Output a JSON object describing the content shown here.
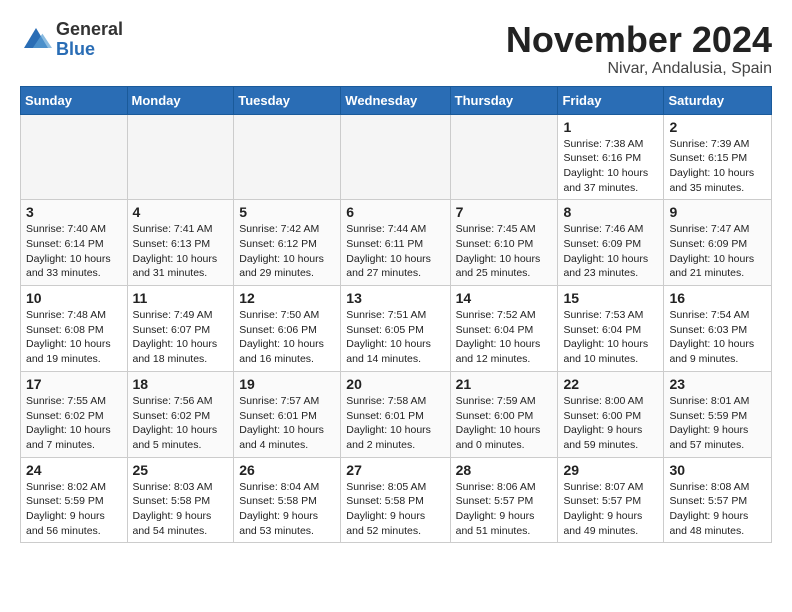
{
  "header": {
    "logo_general": "General",
    "logo_blue": "Blue",
    "month_title": "November 2024",
    "location": "Nivar, Andalusia, Spain"
  },
  "weekdays": [
    "Sunday",
    "Monday",
    "Tuesday",
    "Wednesday",
    "Thursday",
    "Friday",
    "Saturday"
  ],
  "weeks": [
    [
      {
        "day": "",
        "info": ""
      },
      {
        "day": "",
        "info": ""
      },
      {
        "day": "",
        "info": ""
      },
      {
        "day": "",
        "info": ""
      },
      {
        "day": "",
        "info": ""
      },
      {
        "day": "1",
        "info": "Sunrise: 7:38 AM\nSunset: 6:16 PM\nDaylight: 10 hours and 37 minutes."
      },
      {
        "day": "2",
        "info": "Sunrise: 7:39 AM\nSunset: 6:15 PM\nDaylight: 10 hours and 35 minutes."
      }
    ],
    [
      {
        "day": "3",
        "info": "Sunrise: 7:40 AM\nSunset: 6:14 PM\nDaylight: 10 hours and 33 minutes."
      },
      {
        "day": "4",
        "info": "Sunrise: 7:41 AM\nSunset: 6:13 PM\nDaylight: 10 hours and 31 minutes."
      },
      {
        "day": "5",
        "info": "Sunrise: 7:42 AM\nSunset: 6:12 PM\nDaylight: 10 hours and 29 minutes."
      },
      {
        "day": "6",
        "info": "Sunrise: 7:44 AM\nSunset: 6:11 PM\nDaylight: 10 hours and 27 minutes."
      },
      {
        "day": "7",
        "info": "Sunrise: 7:45 AM\nSunset: 6:10 PM\nDaylight: 10 hours and 25 minutes."
      },
      {
        "day": "8",
        "info": "Sunrise: 7:46 AM\nSunset: 6:09 PM\nDaylight: 10 hours and 23 minutes."
      },
      {
        "day": "9",
        "info": "Sunrise: 7:47 AM\nSunset: 6:09 PM\nDaylight: 10 hours and 21 minutes."
      }
    ],
    [
      {
        "day": "10",
        "info": "Sunrise: 7:48 AM\nSunset: 6:08 PM\nDaylight: 10 hours and 19 minutes."
      },
      {
        "day": "11",
        "info": "Sunrise: 7:49 AM\nSunset: 6:07 PM\nDaylight: 10 hours and 18 minutes."
      },
      {
        "day": "12",
        "info": "Sunrise: 7:50 AM\nSunset: 6:06 PM\nDaylight: 10 hours and 16 minutes."
      },
      {
        "day": "13",
        "info": "Sunrise: 7:51 AM\nSunset: 6:05 PM\nDaylight: 10 hours and 14 minutes."
      },
      {
        "day": "14",
        "info": "Sunrise: 7:52 AM\nSunset: 6:04 PM\nDaylight: 10 hours and 12 minutes."
      },
      {
        "day": "15",
        "info": "Sunrise: 7:53 AM\nSunset: 6:04 PM\nDaylight: 10 hours and 10 minutes."
      },
      {
        "day": "16",
        "info": "Sunrise: 7:54 AM\nSunset: 6:03 PM\nDaylight: 10 hours and 9 minutes."
      }
    ],
    [
      {
        "day": "17",
        "info": "Sunrise: 7:55 AM\nSunset: 6:02 PM\nDaylight: 10 hours and 7 minutes."
      },
      {
        "day": "18",
        "info": "Sunrise: 7:56 AM\nSunset: 6:02 PM\nDaylight: 10 hours and 5 minutes."
      },
      {
        "day": "19",
        "info": "Sunrise: 7:57 AM\nSunset: 6:01 PM\nDaylight: 10 hours and 4 minutes."
      },
      {
        "day": "20",
        "info": "Sunrise: 7:58 AM\nSunset: 6:01 PM\nDaylight: 10 hours and 2 minutes."
      },
      {
        "day": "21",
        "info": "Sunrise: 7:59 AM\nSunset: 6:00 PM\nDaylight: 10 hours and 0 minutes."
      },
      {
        "day": "22",
        "info": "Sunrise: 8:00 AM\nSunset: 6:00 PM\nDaylight: 9 hours and 59 minutes."
      },
      {
        "day": "23",
        "info": "Sunrise: 8:01 AM\nSunset: 5:59 PM\nDaylight: 9 hours and 57 minutes."
      }
    ],
    [
      {
        "day": "24",
        "info": "Sunrise: 8:02 AM\nSunset: 5:59 PM\nDaylight: 9 hours and 56 minutes."
      },
      {
        "day": "25",
        "info": "Sunrise: 8:03 AM\nSunset: 5:58 PM\nDaylight: 9 hours and 54 minutes."
      },
      {
        "day": "26",
        "info": "Sunrise: 8:04 AM\nSunset: 5:58 PM\nDaylight: 9 hours and 53 minutes."
      },
      {
        "day": "27",
        "info": "Sunrise: 8:05 AM\nSunset: 5:58 PM\nDaylight: 9 hours and 52 minutes."
      },
      {
        "day": "28",
        "info": "Sunrise: 8:06 AM\nSunset: 5:57 PM\nDaylight: 9 hours and 51 minutes."
      },
      {
        "day": "29",
        "info": "Sunrise: 8:07 AM\nSunset: 5:57 PM\nDaylight: 9 hours and 49 minutes."
      },
      {
        "day": "30",
        "info": "Sunrise: 8:08 AM\nSunset: 5:57 PM\nDaylight: 9 hours and 48 minutes."
      }
    ]
  ]
}
